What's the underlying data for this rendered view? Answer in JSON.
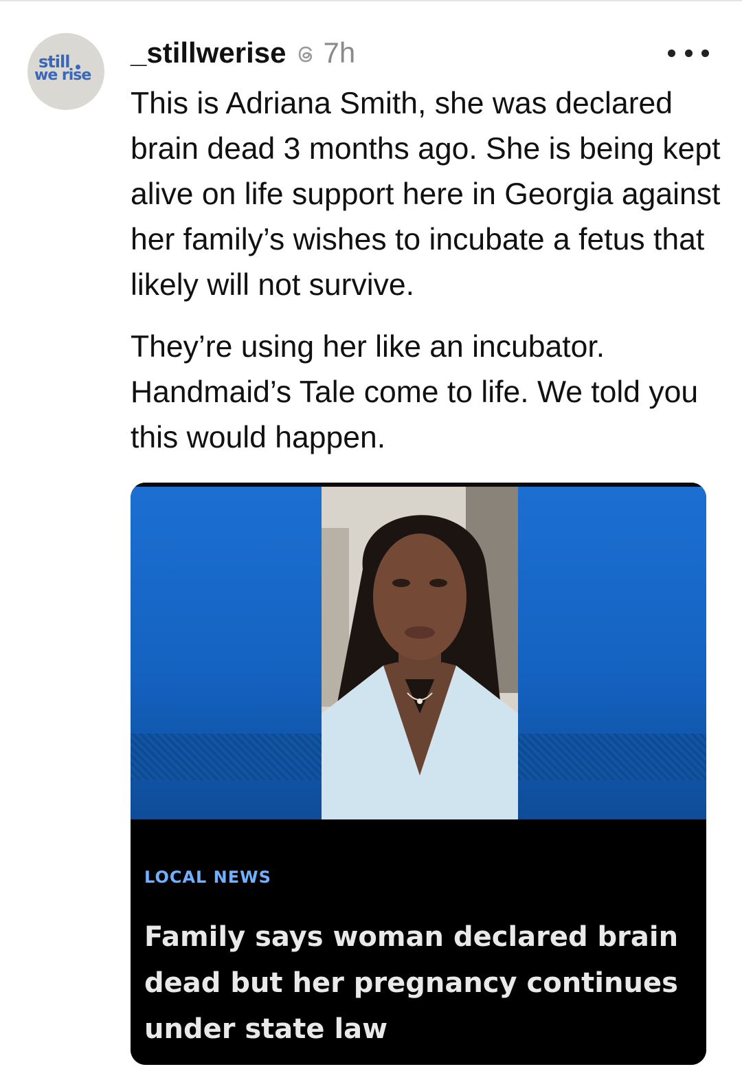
{
  "post": {
    "avatar": {
      "logo_line1": "still",
      "logo_line2": "we rise",
      "brand_color": "#3a67b8",
      "background": "#d9d8d2"
    },
    "username": "_stillwerise",
    "timestamp": "7h",
    "threads_icon": "threads-logo-icon",
    "more_icon": "ellipsis-icon",
    "paragraphs": [
      "This is Adriana Smith, she was declared brain dead 3 months ago. She is being kept alive on life support here in Georgia against her family’s wishes to incubate a fetus that likely will not survive.",
      "They’re using her like an incubator. Handmaid’s Tale come to life. We told you this would happen."
    ]
  },
  "media": {
    "photo_subject": "portrait-photo",
    "category": "LOCAL NEWS",
    "headline": "Family says woman declared brain dead but her pregnancy continues under state law",
    "colors": {
      "panel_blue": "#1565c4",
      "category": "#6fb1ff",
      "headline": "#e9e9e9"
    }
  }
}
